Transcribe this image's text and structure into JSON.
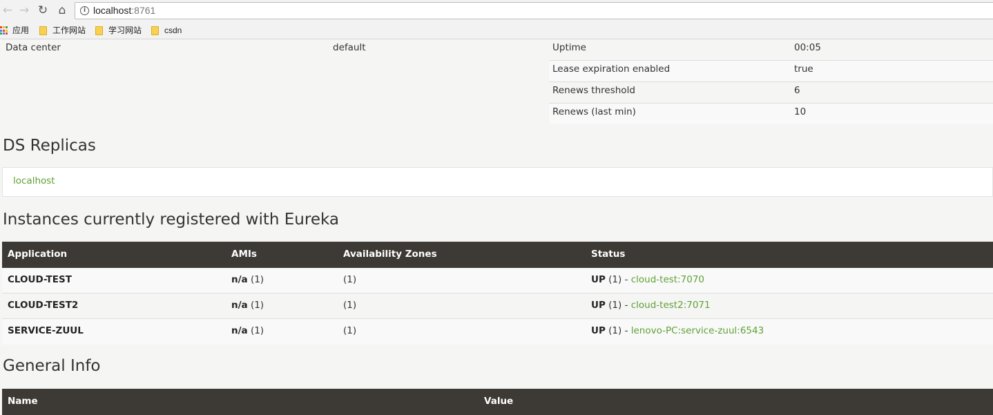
{
  "browser": {
    "url_host": "localhost",
    "url_port": ":8761",
    "bookmarks": [
      {
        "label": "应用",
        "icon": "apps-grid-icon"
      },
      {
        "label": "工作网站",
        "icon": "folder-icon"
      },
      {
        "label": "学习网站",
        "icon": "folder-icon"
      },
      {
        "label": "csdn",
        "icon": "folder-icon"
      }
    ]
  },
  "status": {
    "left": {
      "key": "Data center",
      "value": "default"
    },
    "right": [
      {
        "key": "Uptime",
        "value": "00:05"
      },
      {
        "key": "Lease expiration enabled",
        "value": "true"
      },
      {
        "key": "Renews threshold",
        "value": "6"
      },
      {
        "key": "Renews (last min)",
        "value": "10"
      }
    ]
  },
  "replicas": {
    "title": "DS Replicas",
    "items": [
      "localhost"
    ]
  },
  "instances": {
    "title": "Instances currently registered with Eureka",
    "headers": [
      "Application",
      "AMIs",
      "Availability Zones",
      "Status"
    ],
    "rows": [
      {
        "app": "CLOUD-TEST",
        "amis": "n/a",
        "amis_count": "(1)",
        "zones": "(1)",
        "status": "UP",
        "status_count": "(1) -",
        "link": "cloud-test:7070"
      },
      {
        "app": "CLOUD-TEST2",
        "amis": "n/a",
        "amis_count": "(1)",
        "zones": "(1)",
        "status": "UP",
        "status_count": "(1) -",
        "link": "cloud-test2:7071"
      },
      {
        "app": "SERVICE-ZUUL",
        "amis": "n/a",
        "amis_count": "(1)",
        "zones": "(1)",
        "status": "UP",
        "status_count": "(1) -",
        "link": "lenovo-PC:service-zuul:6543"
      }
    ]
  },
  "general": {
    "title": "General Info",
    "headers": [
      "Name",
      "Value"
    ]
  },
  "colors": {
    "header_bg": "#3d3934",
    "link": "#5fa134",
    "page_bg": "#f5f5f4"
  }
}
